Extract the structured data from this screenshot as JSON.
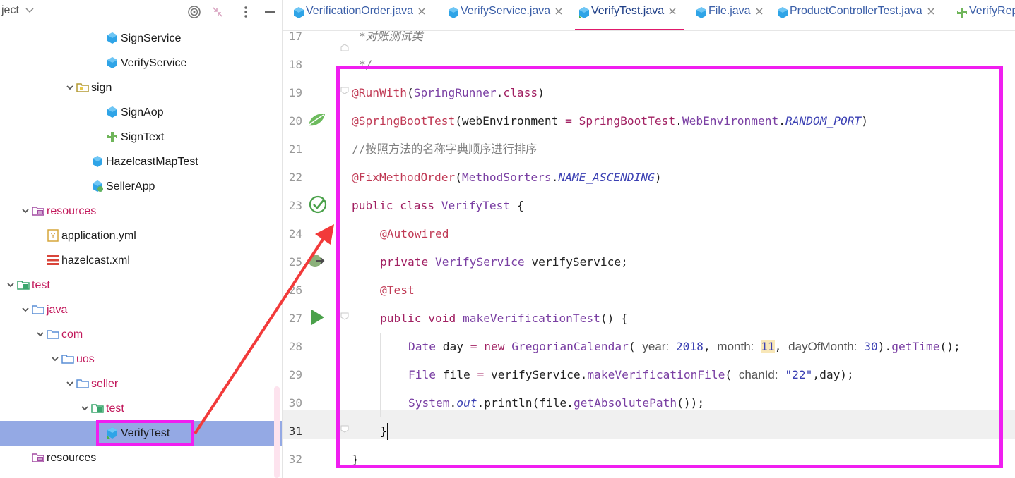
{
  "project_panel": {
    "title": "ject",
    "tree": [
      {
        "label": "SignService",
        "kind": "class",
        "depth": 7,
        "expanded": null,
        "color": "dark"
      },
      {
        "label": "VerifyService",
        "kind": "class",
        "depth": 7,
        "expanded": null,
        "color": "dark"
      },
      {
        "label": "sign",
        "kind": "package",
        "depth": 5,
        "expanded": true,
        "color": "dark"
      },
      {
        "label": "SignAop",
        "kind": "class",
        "depth": 7,
        "expanded": null,
        "color": "dark"
      },
      {
        "label": "SignText",
        "kind": "component",
        "depth": 7,
        "expanded": null,
        "color": "dark"
      },
      {
        "label": "HazelcastMapTest",
        "kind": "class",
        "depth": 6,
        "expanded": null,
        "color": "dark"
      },
      {
        "label": "SellerApp",
        "kind": "app-class",
        "depth": 6,
        "expanded": null,
        "color": "dark"
      },
      {
        "label": "resources",
        "kind": "resources",
        "depth": 2,
        "expanded": true,
        "color": "red"
      },
      {
        "label": "application.yml",
        "kind": "yml",
        "depth": 3,
        "expanded": null,
        "color": "dark"
      },
      {
        "label": "hazelcast.xml",
        "kind": "xml",
        "depth": 3,
        "expanded": null,
        "color": "dark"
      },
      {
        "label": "test",
        "kind": "test-root",
        "depth": 1,
        "expanded": true,
        "color": "red"
      },
      {
        "label": "java",
        "kind": "folder",
        "depth": 2,
        "expanded": true,
        "color": "red"
      },
      {
        "label": "com",
        "kind": "folder",
        "depth": 3,
        "expanded": true,
        "color": "red"
      },
      {
        "label": "uos",
        "kind": "folder",
        "depth": 4,
        "expanded": true,
        "color": "red"
      },
      {
        "label": "seller",
        "kind": "folder",
        "depth": 5,
        "expanded": true,
        "color": "red"
      },
      {
        "label": "test",
        "kind": "test-folder",
        "depth": 6,
        "expanded": true,
        "color": "red"
      },
      {
        "label": "VerifyTest",
        "kind": "test-class",
        "depth": 7,
        "expanded": null,
        "color": "dark",
        "selected": true
      },
      {
        "label": "resources",
        "kind": "resources",
        "depth": 2,
        "expanded": null,
        "color": "dark"
      }
    ]
  },
  "tabs": [
    {
      "label": "VerificationOrder.java",
      "icon": "java-class-icon",
      "active": false
    },
    {
      "label": "VerifyService.java",
      "icon": "java-class-icon",
      "active": false
    },
    {
      "label": "VerifyTest.java",
      "icon": "test-class-icon",
      "active": true
    },
    {
      "label": "File.java",
      "icon": "java-class-icon",
      "active": false
    },
    {
      "label": "ProductControllerTest.java",
      "icon": "java-class-icon",
      "active": false
    },
    {
      "label": "VerifyRep",
      "icon": "component-icon",
      "active": false
    }
  ],
  "editor": {
    "line_numbers": [
      "17",
      "18",
      "19",
      "20",
      "21",
      "22",
      "23",
      "24",
      "25",
      "26",
      "27",
      "28",
      "29",
      "30",
      "31",
      "32"
    ],
    "current_line": "31",
    "lines": {
      "l17": "*对账测试类",
      "l18": "*/",
      "l19": [
        [
          "an",
          "@RunWith"
        ],
        [
          "pl",
          "("
        ],
        [
          "ty",
          "SpringRunner"
        ],
        [
          "pl",
          "."
        ],
        [
          "kw",
          "class"
        ],
        [
          "pl",
          ")"
        ]
      ],
      "l20": [
        [
          "an",
          "@SpringBootTest"
        ],
        [
          "pl",
          "(webEnvironment "
        ],
        [
          "kw",
          "="
        ],
        [
          "pl",
          " "
        ],
        [
          "kw",
          "SpringBootTest"
        ],
        [
          "pl",
          "."
        ],
        [
          "ty",
          "WebEnvironment"
        ],
        [
          "pl",
          "."
        ],
        [
          "it",
          "RANDOM_PORT"
        ],
        [
          "pl",
          ")"
        ]
      ],
      "l21": "//按照方法的名称字典顺序进行排序",
      "l22": [
        [
          "an",
          "@FixMethodOrder"
        ],
        [
          "pl",
          "("
        ],
        [
          "ty",
          "MethodSorters"
        ],
        [
          "pl",
          "."
        ],
        [
          "it",
          "NAME_ASCENDING"
        ],
        [
          "pl",
          ")"
        ]
      ],
      "l23": [
        [
          "kw",
          "public class "
        ],
        [
          "ty",
          "VerifyTest"
        ],
        [
          "pl",
          " {"
        ]
      ],
      "l24": [
        [
          "an",
          "@Autowired"
        ]
      ],
      "l25": [
        [
          "kw",
          "private "
        ],
        [
          "ty",
          "VerifyService"
        ],
        [
          "pl",
          " verifyService;"
        ]
      ],
      "l26": [
        [
          "an",
          "@Test"
        ]
      ],
      "l27": [
        [
          "kw",
          "public void "
        ],
        [
          "ty",
          "makeVerificationTest"
        ],
        [
          "pl",
          "() {"
        ]
      ],
      "l28": [
        [
          "ty",
          "Date"
        ],
        [
          "pl",
          " day "
        ],
        [
          "kw",
          "="
        ],
        [
          "pl",
          " "
        ],
        [
          "kw",
          "new "
        ],
        [
          "ty",
          "GregorianCalendar"
        ],
        [
          "pl",
          "( "
        ],
        [
          "hint",
          "year:"
        ],
        [
          "pl",
          " "
        ],
        [
          "num",
          "2018"
        ],
        [
          "pl",
          ", "
        ],
        [
          "hint",
          "month:"
        ],
        [
          "pl",
          " "
        ],
        [
          "numhl",
          "11"
        ],
        [
          "pl",
          ", "
        ],
        [
          "hint",
          "dayOfMonth:"
        ],
        [
          "pl",
          " "
        ],
        [
          "num",
          "30"
        ],
        [
          "pl",
          ")."
        ],
        [
          "ty",
          "getTime"
        ],
        [
          "pl",
          "();"
        ]
      ],
      "l29": [
        [
          "ty",
          "File"
        ],
        [
          "pl",
          " file "
        ],
        [
          "kw",
          "="
        ],
        [
          "pl",
          " verifyService."
        ],
        [
          "ty",
          "makeVerificationFile"
        ],
        [
          "pl",
          "( "
        ],
        [
          "hint",
          "chanId:"
        ],
        [
          "pl",
          " "
        ],
        [
          "st",
          "\"22\""
        ],
        [
          "pl",
          ",day);"
        ]
      ],
      "l30": [
        [
          "ty",
          "System"
        ],
        [
          "pl",
          "."
        ],
        [
          "it",
          "out"
        ],
        [
          "pl",
          ".println(file."
        ],
        [
          "ty",
          "getAbsolutePath"
        ],
        [
          "pl",
          "());"
        ]
      ],
      "l31": "}",
      "l32": "}"
    }
  },
  "colors": {
    "accent": "#e0196b",
    "annotation": "#f01ef0",
    "arrow": "#f23a3a",
    "selection": "#94a9e4"
  }
}
